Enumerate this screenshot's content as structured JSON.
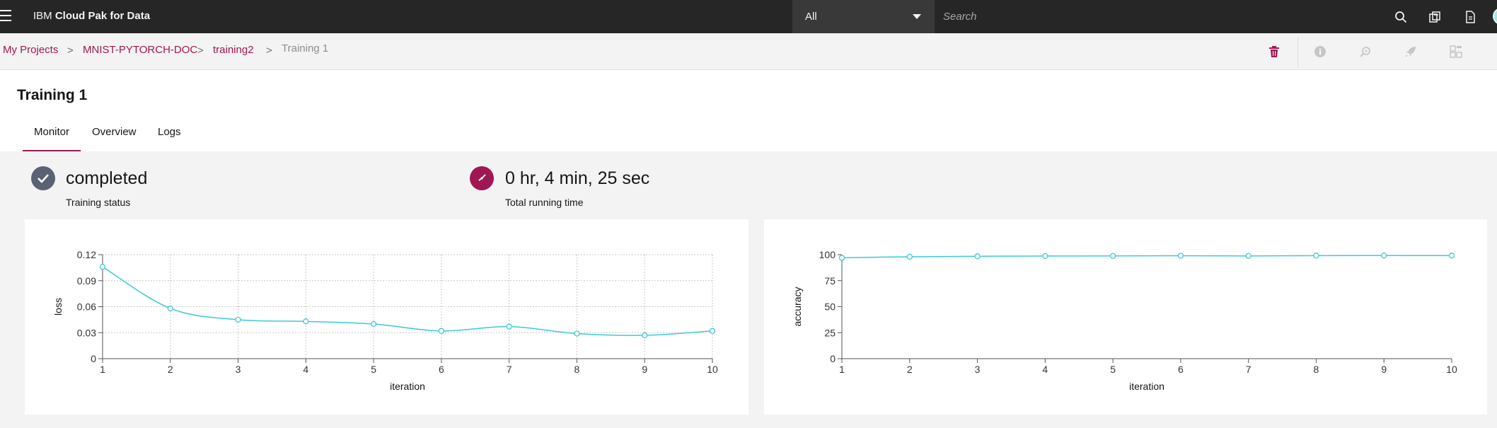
{
  "header": {
    "brand_prefix": "IBM",
    "brand_name": "Cloud Pak for Data",
    "scope_value": "All",
    "search_placeholder": "Search"
  },
  "breadcrumb": {
    "items": [
      "My Projects",
      "MNIST-PYTORCH-DOC",
      "training2"
    ],
    "current": "Training 1",
    "separator": ">"
  },
  "page": {
    "title": "Training 1",
    "tabs": [
      "Monitor",
      "Overview",
      "Logs"
    ],
    "active_tab": "Monitor"
  },
  "status": {
    "training_status_value": "completed",
    "training_status_label": "Training status",
    "running_time_value": "0 hr, 4 min, 25 sec",
    "running_time_label": "Total running time"
  },
  "colors": {
    "accent": "#9f1853",
    "line": "#3ec9d6",
    "status_gray": "#5a6273",
    "header_bg": "#262626"
  },
  "icons": [
    "hamburger-icon",
    "search-icon",
    "catalog-icon",
    "document-icon",
    "trash-icon",
    "info-icon",
    "deploy-icon",
    "rocket-icon",
    "grid-icon",
    "checkmark-icon",
    "clock-icon"
  ],
  "chart_data": [
    {
      "type": "line",
      "xlabel": "iteration",
      "ylabel": "loss",
      "x": [
        1,
        2,
        3,
        4,
        5,
        6,
        7,
        8,
        9,
        10
      ],
      "values": [
        0.106,
        0.058,
        0.045,
        0.043,
        0.04,
        0.032,
        0.037,
        0.029,
        0.027,
        0.032
      ],
      "xlim": [
        1,
        10
      ],
      "ylim": [
        0,
        0.12
      ],
      "yticks": [
        "0",
        "0.03",
        "0.06",
        "0.09",
        "0.12"
      ],
      "xticks": [
        "1",
        "2",
        "3",
        "4",
        "5",
        "6",
        "7",
        "8",
        "9",
        "10"
      ],
      "grid": true
    },
    {
      "type": "line",
      "xlabel": "iteration",
      "ylabel": "accuracy",
      "x": [
        1,
        2,
        3,
        4,
        5,
        6,
        7,
        8,
        9,
        10
      ],
      "values": [
        97,
        98,
        98.5,
        98.7,
        98.8,
        99,
        98.8,
        99.1,
        99.2,
        99.1
      ],
      "xlim": [
        1,
        10
      ],
      "ylim": [
        0,
        100
      ],
      "yticks": [
        "0",
        "25",
        "50",
        "75",
        "100"
      ],
      "xticks": [
        "1",
        "2",
        "3",
        "4",
        "5",
        "6",
        "7",
        "8",
        "9",
        "10"
      ],
      "grid": false
    }
  ]
}
